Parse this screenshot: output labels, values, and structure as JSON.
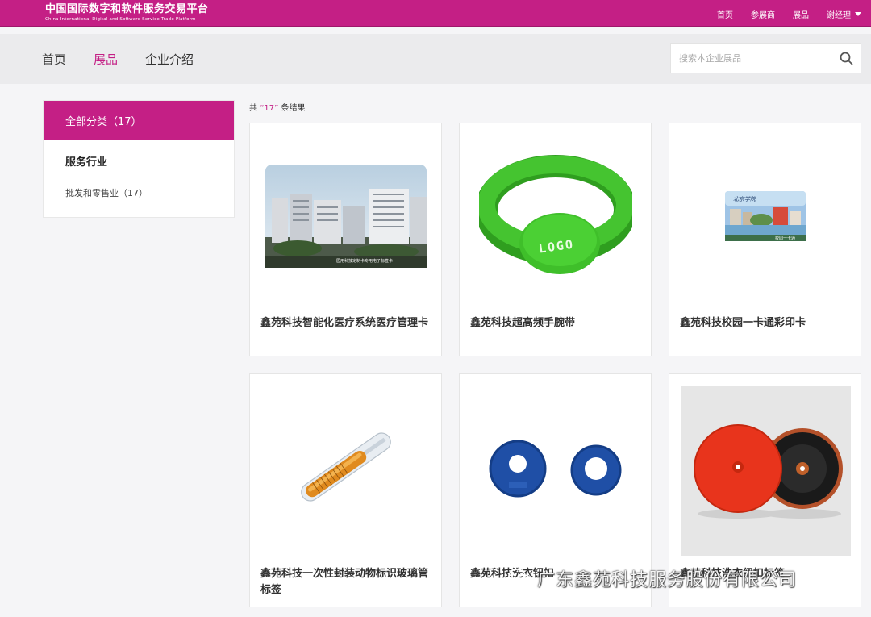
{
  "header": {
    "logo_cn": "中国国际数字和软件服务交易平台",
    "logo_en": "China International Digital and Software Service Trade Platform",
    "nav": [
      {
        "label": "首页"
      },
      {
        "label": "参展商"
      },
      {
        "label": "展品"
      }
    ],
    "user_label": "谢经理"
  },
  "subnav": {
    "tabs": [
      {
        "label": "首页"
      },
      {
        "label": "展品"
      },
      {
        "label": "企业介绍"
      }
    ],
    "active_tab": "展品",
    "search_placeholder": "搜索本企业展品"
  },
  "sidebar": {
    "all_label": "全部分类（17）",
    "group_label": "服务行业",
    "sub_label": "批发和零售业（17）"
  },
  "results": {
    "prefix": "共 ",
    "count": "“17”",
    "suffix": " 条结果"
  },
  "products": [
    {
      "title": "鑫苑科技智能化医疗系统医疗管理卡",
      "image": "hospital-card"
    },
    {
      "title": "鑫苑科技超高频手腕带",
      "image": "wristband"
    },
    {
      "title": "鑫苑科技校园一卡通彩印卡",
      "image": "campus-card"
    },
    {
      "title": "鑫苑科技一次性封装动物标识玻璃管标签",
      "image": "glass-tube-tag"
    },
    {
      "title": "鑫苑科技洗衣钮扣",
      "image": "blue-rings"
    },
    {
      "title": "鑫苑科技洗衣纽扣标签",
      "image": "red-black-discs"
    }
  ],
  "image_text": {
    "hospital_caption": "医用科技定制卡专用电子标签卡",
    "wristband_logo": "LOGO",
    "campus_header": "北京学院",
    "campus_footer": "校园一卡通"
  },
  "watermark": {
    "icon": "wechat-icon",
    "text": "广东鑫苑科技服务股份有限公司"
  },
  "colors": {
    "brand": "#c41f85",
    "wristband_green": "#3fbf2a",
    "ring_blue": "#1f4fa6",
    "disc_red": "#e8341c"
  }
}
